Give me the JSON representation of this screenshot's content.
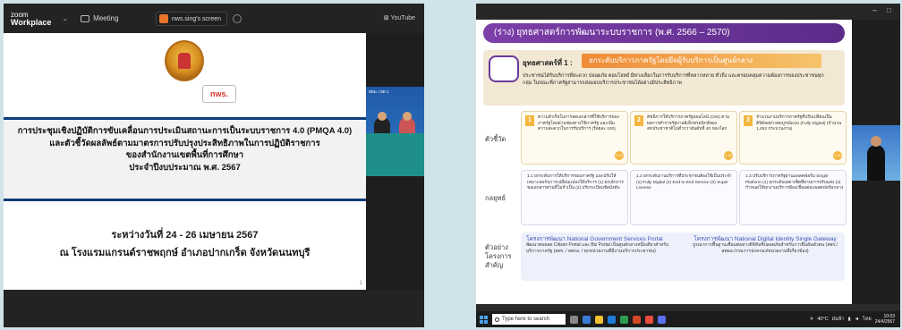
{
  "left": {
    "topbar": {
      "brand_line1": "zoom",
      "brand_line2": "Workplace",
      "meeting_label": "Meeting",
      "share_label": "nws.sing's screen",
      "youtube_label": "YouTube"
    },
    "slide": {
      "logo_text": "nws.",
      "title_lines": [
        "การประชุมเชิงปฏิบัติการขับเคลื่อนการประเมินสถานะการเป็นระบบราชการ 4.0 (PMQA 4.0)",
        "และตัวชี้วัดผลลัพธ์ตามมาตรการปรับปรุงประสิทธิภาพในการปฏิบัติราชการ",
        "ของสำนักงานเขตพื้นที่การศึกษา",
        "ประจำปีงบประมาณ พ.ศ. 2567"
      ],
      "date_line": "ระหว่างวันที่ 24 - 26 เมษายน 2567",
      "venue_line": "ณ โรงแรมแกรนด์ราชพฤกษ์ อำเภอปากเกร็ด จังหวัดนนทบุรี",
      "page_number": "1"
    },
    "speaker_caption": "สพม. เขต 1"
  },
  "right": {
    "window": {
      "minimize": "–",
      "maximize": "□"
    },
    "slide": {
      "header": "(ร่าง) ยุทธศาสตร์การพัฒนาระบบราชการ (พ.ศ. 2566 – 2570)",
      "logo_text": "nws",
      "strategy_label": "ยุทธศาสตร์ที่ 1 :",
      "strategy_title": "ยกระดับบริการภาครัฐโดยยึดผู้รับบริการเป็นศูนย์กลาง",
      "strategy_desc": "ประชาชนได้รับบริการที่สะดวก ปลอดภัย ตอบโจทย์ มีทางเลือกในการรับบริการที่หลากหลาย ทั่วถึง และครอบคลุมความต้องการของประชาชนทุกกลุ่ม ในขณะที่ภาครัฐสามารถส่งมอบบริการประชาชนได้อย่างมีประสิทธิภาพ",
      "row_labels": [
        "ตัวชี้วัด",
        "กลยุทธ์",
        "ตัวอย่างโครงการสำคัญ"
      ],
      "indicators": [
        {
          "num": "1",
          "text": "ความสำเร็จในการลดเอกสารที่ใช้บริการของภาครัฐโดยผ่านช่องทางใช้ภาครัฐ และเพิ่มความสะดวกในการรับบริการ (ร้อยละ 100)",
          "badge": "1.20"
        },
        {
          "num": "2",
          "text": "ดัชนีการให้บริการภาครัฐออนไลน์ (OSI) ตามผลการสำรวจรัฐบาลอิเล็กทรอนิกส์ของสหประชาชาติไม่ต่ำกว่าอันดับที่ 40 ของโลก",
          "badge": "1.15"
        },
        {
          "num": "3",
          "text": "จำนวนงานบริการภาครัฐที่ปรับเปลี่ยนเป็นดิจิทัลอย่างสมบูรณ์แบบ (Fully Digital) (จำนวน 1,452 กระบวนงาน)",
          "badge": "1.20"
        }
      ],
      "tactics": [
        "1.1 ยกระดับการให้บริการของภาครัฐ และปรับให้เหมาะสมกับการเปลี่ยนแปลงให้บริการ (1) ยกเลิกการขอเอกสารส่วนที่ไม่จำเป็น (2) ปรับระเบียบข้อบังคับ",
        "1.2 ยกระดับงานบริการที่ประชาชนต้องใช้เป็นประจำ (1) Fully Digital (2) End to End Service (3) Super License",
        "1.3 ปรับบริการภาครัฐผ่านแพลตฟอร์ม Single Platform (1) ยกระดับเดตาเซ็ตที่ผ่านการปรับแต่ง (2) กำหนดให้ทุกงานบริการต้องเชื่อมต่อแพลตฟอร์มกลาง"
      ],
      "projects": [
        {
          "heading": "โครงการพัฒนา National Government Services Portal",
          "text": "พัฒนาต่อยอด Citizen Portal และ Biz Portal เป็นศูนย์กลางหนึ่งเดียวสำหรับบริการภาครัฐ (สพร. / สพรอ. / ทุกหน่วยงานที่มีงานบริการประชาชน)"
        },
        {
          "heading": "โครงการพัฒนา National Digital Identity Single Gateway",
          "text": "บูรณาการพื้นฐานเชื่อมต่อทางดิจิทัลที่ปลอดภัยสำหรับการยืนยันตัวตน (สพร./สพธอ./กรมการปกครอง/หน่วยงานที่เกี่ยวข้อง)"
        }
      ]
    },
    "taskbar": {
      "search_placeholder": "Type here to search",
      "weather": "40°C",
      "weather_desc": "ฝนฟ้า",
      "lang": "ไทย",
      "time": "10:03",
      "date": "24/4/2567"
    }
  },
  "colors": {
    "accent_purple": "#6a3a9a",
    "accent_orange": "#ef8b37",
    "title_border": "#0f3d7a",
    "brand_red": "#d4342b"
  }
}
